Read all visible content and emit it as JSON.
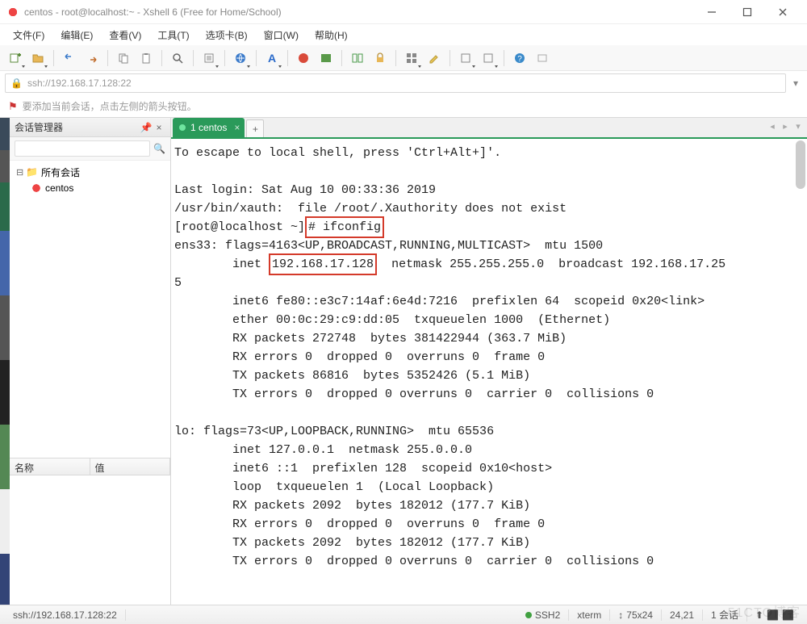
{
  "window": {
    "title": "centos - root@localhost:~ - Xshell 6 (Free for Home/School)"
  },
  "menu": {
    "file": "文件(F)",
    "edit": "编辑(E)",
    "view": "查看(V)",
    "tools": "工具(T)",
    "tabs": "选项卡(B)",
    "window": "窗口(W)",
    "help": "帮助(H)"
  },
  "addressbar": {
    "url": "ssh://192.168.17.128:22"
  },
  "tipbar": {
    "text": "要添加当前会话，点击左侧的箭头按钮。"
  },
  "sidepanel": {
    "title": "会话管理器",
    "search_placeholder": "",
    "root": "所有会话",
    "items": [
      "centos"
    ],
    "columns": {
      "name": "名称",
      "value": "值"
    }
  },
  "tabs": [
    {
      "label": "1 centos",
      "active": true
    }
  ],
  "terminal": {
    "lines": [
      "To escape to local shell, press 'Ctrl+Alt+]'.",
      "",
      "Last login: Sat Aug 10 00:33:36 2019",
      "/usr/bin/xauth:  file /root/.Xauthority does not exist",
      "[root@localhost ~]",
      "ens33: flags=4163<UP,BROADCAST,RUNNING,MULTICAST>  mtu 1500",
      "        inet ",
      "5",
      "        inet6 fe80::e3c7:14af:6e4d:7216  prefixlen 64  scopeid 0x20<link>",
      "        ether 00:0c:29:c9:dd:05  txqueuelen 1000  (Ethernet)",
      "        RX packets 272748  bytes 381422944 (363.7 MiB)",
      "        RX errors 0  dropped 0  overruns 0  frame 0",
      "        TX packets 86816  bytes 5352426 (5.1 MiB)",
      "        TX errors 0  dropped 0 overruns 0  carrier 0  collisions 0",
      "",
      "lo: flags=73<UP,LOOPBACK,RUNNING>  mtu 65536",
      "        inet 127.0.0.1  netmask 255.0.0.0",
      "        inet6 ::1  prefixlen 128  scopeid 0x10<host>",
      "        loop  txqueuelen 1  (Local Loopback)",
      "        RX packets 2092  bytes 182012 (177.7 KiB)",
      "        RX errors 0  dropped 0  overruns 0  frame 0",
      "        TX packets 2092  bytes 182012 (177.7 KiB)",
      "        TX errors 0  dropped 0 overruns 0  carrier 0  collisions 0"
    ],
    "highlight_cmd": "# ifconfig",
    "highlight_ip": "192.168.17.128",
    "inet_tail": "  netmask 255.255.255.0  broadcast 192.168.17.25"
  },
  "statusbar": {
    "conn": "ssh://192.168.17.128:22",
    "proto": "SSH2",
    "term": "xterm",
    "size": "75x24",
    "cursor": "24,21",
    "sessions": "1 会话"
  },
  "watermark": "51CTO博客"
}
